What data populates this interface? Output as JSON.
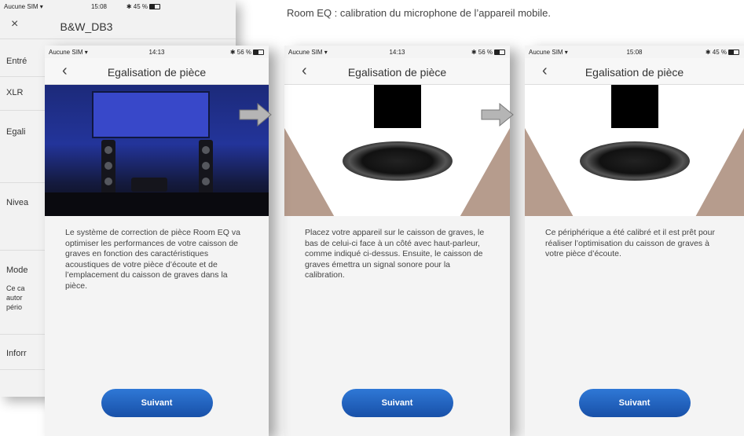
{
  "caption": "Room EQ : calibration du microphone de l’appareil mobile.",
  "background_phone": {
    "status": {
      "carrier": "Aucune SIM ▾",
      "time": "15:08",
      "battery": "✱ 45 %"
    },
    "title": "B&W_DB3",
    "close_icon": "×",
    "rows": [
      "Entré",
      "XLR",
      "Egali",
      "Nivea",
      "Mode",
      "Ce ca",
      "autor",
      "pério",
      "Inforr"
    ]
  },
  "screens": [
    {
      "status": {
        "carrier": "Aucune SIM ▾",
        "time": "14:13",
        "battery": "✱ 56 %"
      },
      "back_icon": "‹",
      "title": "Egalisation de pièce",
      "text": "Le système de correction de pièce Room EQ va optimiser les performances de votre caisson de graves en fonction des caractéristiques acoustiques de votre pièce d’écoute et de l’emplacement du caisson de graves dans la pièce.",
      "button": "Suivant"
    },
    {
      "status": {
        "carrier": "Aucune SIM ▾",
        "time": "14:13",
        "battery": "✱ 56 %"
      },
      "back_icon": "‹",
      "title": "Egalisation de pièce",
      "text": "Placez votre appareil sur le caisson de graves, le bas de celui-ci face à un côté avec haut-parleur, comme indiqué ci-dessus. Ensuite, le caisson de graves émettra un signal sonore pour la calibration.",
      "button": "Suivant"
    },
    {
      "status": {
        "carrier": "Aucune SIM ▾",
        "time": "15:08",
        "battery": "✱ 45 %"
      },
      "back_icon": "‹",
      "title": "Egalisation de pièce",
      "text": "Ce périphérique a été calibré et il est prêt pour réaliser l’optimisation du caisson de graves à votre pièce d’écoute.",
      "button": "Suivant"
    }
  ],
  "colors": {
    "button": "#1f5fbf",
    "room_wall": "#23349a",
    "floor_beige": "#b69c8d"
  }
}
